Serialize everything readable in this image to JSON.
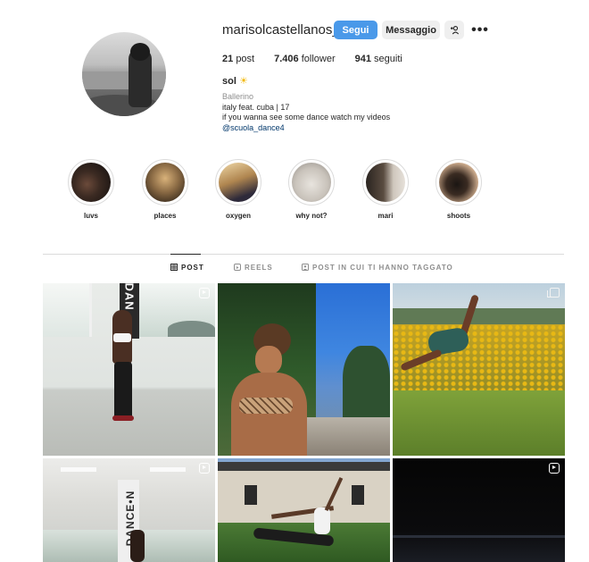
{
  "profile": {
    "username": "marisolcastellanos_",
    "follow_label": "Segui",
    "message_label": "Messaggio",
    "add_user_glyph": "+1",
    "more_glyph": "•••",
    "posts_count": "21",
    "posts_label": "post",
    "followers_count": "7.406",
    "followers_label": "follower",
    "following_count": "941",
    "following_label": "seguiti",
    "full_name": "sol",
    "full_name_emoji": "☀",
    "category": "Ballerino",
    "bio_line1": "italy feat. cuba | 17",
    "bio_line2": "if you wanna see some dance watch my videos",
    "bio_link": "@scuola_dance4"
  },
  "highlights": [
    {
      "label": "luvs"
    },
    {
      "label": "places"
    },
    {
      "label": "oxygen"
    },
    {
      "label": "why not?"
    },
    {
      "label": "mari"
    },
    {
      "label": "shoots"
    }
  ],
  "tabs": [
    {
      "label": "POST",
      "icon": "grid-icon",
      "active": true
    },
    {
      "label": "REELS",
      "icon": "reels-icon",
      "active": false
    },
    {
      "label": "POST IN CUI TI HANNO TAGGATO",
      "icon": "tagged-icon",
      "active": false
    }
  ],
  "colors": {
    "follow_button": "#4a99e9",
    "secondary_button": "#efefef",
    "link": "#00376b",
    "muted": "#8e8e8e"
  },
  "posts": [
    {
      "type": "reel"
    },
    {
      "type": "photo"
    },
    {
      "type": "carousel"
    },
    {
      "type": "reel"
    },
    {
      "type": "photo"
    },
    {
      "type": "reel"
    }
  ],
  "post_overlay_texts": {
    "post1": "DAN",
    "post4": "DANCE•N"
  }
}
